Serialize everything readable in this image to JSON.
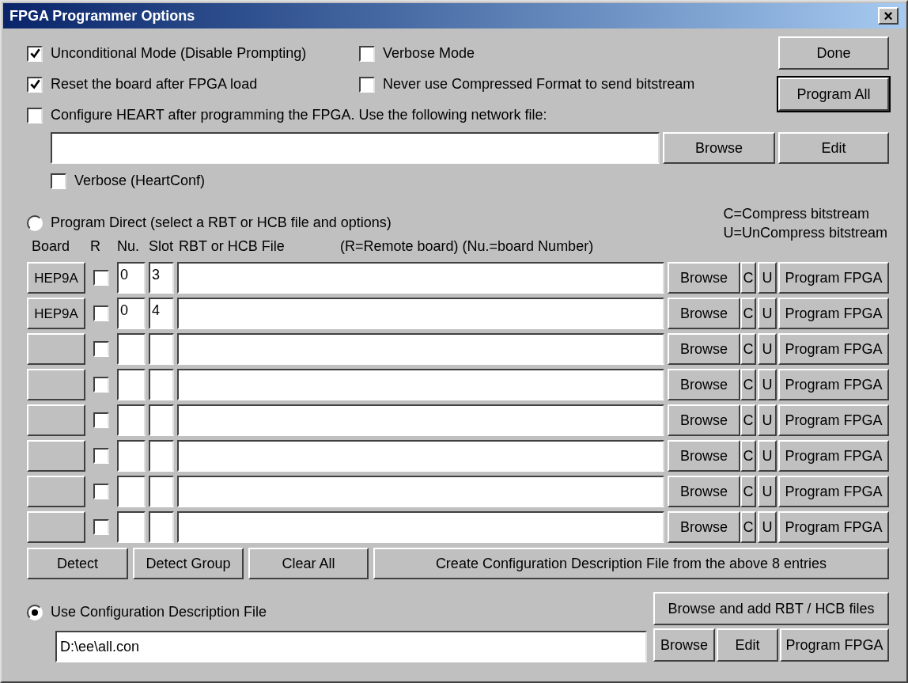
{
  "window": {
    "title": "FPGA Programmer Options",
    "close_glyph": "×"
  },
  "options_left": [
    {
      "label": "Unconditional Mode (Disable Prompting)",
      "checked": true
    },
    {
      "label": "Reset the board after FPGA load",
      "checked": true
    }
  ],
  "options_right": [
    {
      "label": "Verbose Mode",
      "checked": false
    },
    {
      "label": "Never use Compressed Format to send bitstream",
      "checked": false
    }
  ],
  "side_buttons": [
    "Done",
    "Program All"
  ],
  "heart": {
    "label": "Configure HEART after programming the FPGA. Use the following network file:",
    "checked": false,
    "browse": "Browse",
    "edit": "Edit",
    "verbose": {
      "label": "Verbose (HeartConf)",
      "checked": false
    }
  },
  "program_direct": {
    "label": "Program Direct (select a RBT or HCB file and options)",
    "selected": false
  },
  "legend": [
    "C=Compress bitstream",
    "U=UnCompress bitstream"
  ],
  "columns": [
    "Board",
    "R",
    "Nu.",
    "Slot",
    "RBT or HCB File",
    "(R=Remote board) (Nu.=board Number)"
  ],
  "entries": [
    {
      "board": "HEP9A",
      "remote": false,
      "number": "0",
      "slot": "3",
      "browse": "Browse",
      "c": "C",
      "u": "U",
      "program": "Program FPGA"
    },
    {
      "board": "HEP9A",
      "remote": false,
      "number": "0",
      "slot": "4",
      "browse": "Browse",
      "c": "C",
      "u": "U",
      "program": "Program FPGA"
    },
    {
      "remote": false,
      "browse": "Browse",
      "c": "C",
      "u": "U",
      "program": "Program FPGA"
    },
    {
      "remote": false,
      "browse": "Browse",
      "c": "C",
      "u": "U",
      "program": "Program FPGA"
    },
    {
      "remote": false,
      "browse": "Browse",
      "c": "C",
      "u": "U",
      "program": "Program FPGA"
    },
    {
      "remote": false,
      "browse": "Browse",
      "c": "C",
      "u": "U",
      "program": "Program FPGA"
    },
    {
      "remote": false,
      "browse": "Browse",
      "c": "C",
      "u": "U",
      "program": "Program FPGA"
    },
    {
      "remote": false,
      "browse": "Browse",
      "c": "C",
      "u": "U",
      "program": "Program FPGA"
    }
  ],
  "action_buttons": [
    "Detect",
    "Detect Group",
    "Clear All",
    "Create Configuration Description File from the above 8 entries"
  ],
  "use_config": {
    "label": "Use Configuration Description File",
    "selected": true,
    "value": "D:\\ee\\all.con",
    "add_button": "Browse and add RBT / HCB files",
    "buttons": [
      "Browse",
      "Edit",
      "Program FPGA"
    ]
  }
}
